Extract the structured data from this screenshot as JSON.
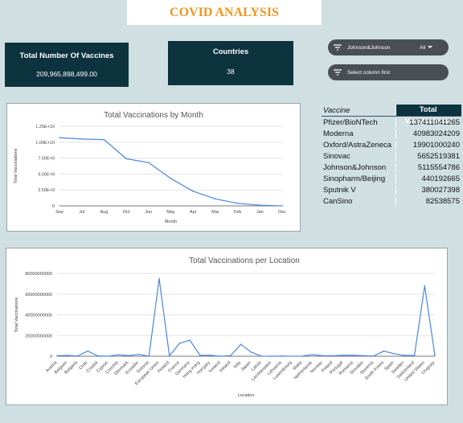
{
  "header": {
    "title": "COVID ANALYSIS"
  },
  "kpis": {
    "vaccines_label": "Total Number Of Vaccines",
    "vaccines_value": "209,965,898,499.00",
    "countries_label": "Countries",
    "countries_value": "38"
  },
  "filters": {
    "vaccine_filter": {
      "label": "Johnson&Johnson",
      "value": "All"
    },
    "column_filter": {
      "label": "Select column first"
    }
  },
  "table": {
    "headers": [
      "Vaccine",
      "Total Vaccinations"
    ],
    "rows": [
      [
        "Pfizer/BioNTech",
        "137411041265"
      ],
      [
        "Moderna",
        "40983024209"
      ],
      [
        "Oxford/AstraZeneca",
        "19901000240"
      ],
      [
        "Sinovac",
        "5652519381"
      ],
      [
        "Johnson&Johnson",
        "5115554786"
      ],
      [
        "Sinopharm/Beijing",
        "440192665"
      ],
      [
        "Sputnik V",
        "380027398"
      ],
      [
        "CanSino",
        "82538575"
      ]
    ]
  },
  "colors": {
    "accent": "#f0961e",
    "dark": "#0d333f",
    "line": "#4a86e8",
    "background": "#cfdfe2"
  },
  "chart_data": [
    {
      "type": "line",
      "title": "Total Vaccinations by Month",
      "xlabel": "Month",
      "ylabel": "Total Vaccinations",
      "categories": [
        "Sep",
        "Jul",
        "Aug",
        "Oct",
        "Jun",
        "May",
        "Apr",
        "Mar",
        "Feb",
        "Jan",
        "Dec"
      ],
      "values": [
        10700000000,
        10500000000,
        10400000000,
        7400000000,
        6800000000,
        4300000000,
        2300000000,
        1100000000,
        400000000,
        100000000,
        0
      ],
      "ylim": [
        0,
        12500000000
      ],
      "yticks": [
        0,
        2500000000,
        5000000000,
        7500000000,
        10000000000,
        12500000000
      ],
      "ytick_labels": [
        "0",
        "2.50E+9",
        "5.00E+9",
        "7.50E+9",
        "1.00E+10",
        "1.25E+10"
      ],
      "grid": true
    },
    {
      "type": "line",
      "title": "Total Vaccinations per Location",
      "xlabel": "Location",
      "ylabel": "Total Vaccinations",
      "categories": [
        "Austria",
        "Belgium",
        "Bulgaria",
        "Chile",
        "Croatia",
        "Cyprus",
        "Czechia",
        "Denmark",
        "Ecuador",
        "Estonia",
        "European Union",
        "Finland",
        "France",
        "Germany",
        "Hong Kong",
        "Hungary",
        "Iceland",
        "Ireland",
        "Italy",
        "Japan",
        "Latvia",
        "Liechtenstein",
        "Lithuania",
        "Luxembourg",
        "Malta",
        "Netherlands",
        "Norway",
        "Poland",
        "Portugal",
        "Romania",
        "Slovakia",
        "Slovenia",
        "South Korea",
        "Spain",
        "Sweden",
        "Switzerland",
        "United States",
        "Uruguay"
      ],
      "values": [
        500000000,
        800000000,
        300000000,
        5000000000,
        300000000,
        50000000,
        1500000000,
        600000000,
        1800000000,
        100000000,
        75000000000,
        400000000,
        12500000000,
        15500000000,
        900000000,
        1000000000,
        30000000,
        600000000,
        11500000000,
        4000000000,
        150000000,
        5000000,
        250000000,
        60000000,
        50000000,
        1700000000,
        500000000,
        500000000,
        1000000000,
        1000000000,
        500000000,
        200000000,
        5000000000,
        2500000000,
        800000000,
        800000000,
        68000000000,
        800000000
      ],
      "ylim": [
        0,
        80000000000
      ],
      "yticks": [
        0,
        20000000000,
        40000000000,
        60000000000,
        80000000000
      ],
      "ytick_labels": [
        "0",
        "20000000000",
        "40000000000",
        "60000000000",
        "80000000000"
      ],
      "grid": true
    }
  ]
}
